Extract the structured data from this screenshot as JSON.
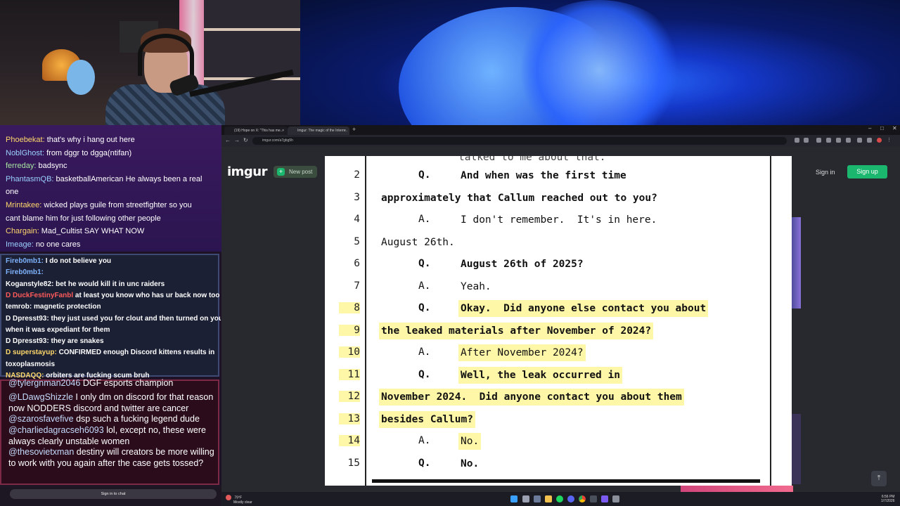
{
  "chat": {
    "top_messages": [
      {
        "user": "Phoebekat:",
        "color": "#ffd86b",
        "text": "that's why i hang out here"
      },
      {
        "user": "NoblGhost:",
        "color": "#9ad1ff",
        "text": "from dggr to dgga(ntifan)"
      },
      {
        "user": "ferreday:",
        "color": "#a8e6a0",
        "text": "badsync"
      },
      {
        "user": "PhantasmQB:",
        "color": "#9ad1ff",
        "text": "basketballAmerican He always been a real"
      },
      {
        "user": "",
        "color": "#ffffff",
        "text": "one"
      },
      {
        "user": "Mrintakee:",
        "color": "#ffd86b",
        "text": "wicked plays guile from streetfighter so you"
      },
      {
        "user": "",
        "color": "#ffffff",
        "text": "cant blame him for just following other people"
      },
      {
        "user": "Chargain:",
        "color": "#ffd86b",
        "text": "Mad_Cultist SAY WHAT NOW"
      },
      {
        "user": "Imeage:",
        "color": "#9ad1ff",
        "text": "no one cares"
      }
    ],
    "mid_messages": [
      {
        "user": "Fireb0mb1:",
        "color": "#7fb4ff",
        "text": "I do not believe you"
      },
      {
        "user": "Fireb0mb1:",
        "color": "#7fb4ff",
        "text": ""
      },
      {
        "user": "Koganstyle82:",
        "color": "#ffffff",
        "text": "bet he would kill it in unc raiders"
      },
      {
        "user": "D DuckFestinyFanbl",
        "color": "#ff5a5a",
        "text": "at least you know who has ur back now too"
      },
      {
        "user": "temrob:",
        "color": "#ffffff",
        "text": "magnetic protection"
      },
      {
        "user": "D Dpresst93:",
        "color": "#ffffff",
        "text": "they just used you for clout and then turned on you"
      },
      {
        "user": "",
        "color": "#ffffff",
        "text": "when it was expediant for them"
      },
      {
        "user": "D Dpresst93:",
        "color": "#ffffff",
        "text": "they are snakes"
      },
      {
        "user": "D superstayup:",
        "color": "#ffd86b",
        "text": "CONFIRMED enough Discord kittens results in"
      },
      {
        "user": "",
        "color": "#ffffff",
        "text": "toxoplasmosis"
      },
      {
        "user": "NASDAQQ:",
        "color": "#ffd86b",
        "text": "orbiters are fucking scum bruh"
      }
    ],
    "bottom_messages": [
      {
        "mention": "@tylergnman2046",
        "text": "DGF esports champion"
      },
      {
        "mention": "@LDawgShizzle",
        "text": "I only dm on discord for that reason now NODDERS discord and twitter are cancer"
      },
      {
        "mention": "@szarosfavefive",
        "text": "dsp such a fucking legend dude"
      },
      {
        "mention": "@charliedagracseh6093",
        "text": "lol, except no, these were always clearly unstable women"
      },
      {
        "mention": "@thesovietxman",
        "text": "destiny will creators be more willing to work with you again after the case gets tossed?"
      }
    ],
    "signin_label": "Sign in to chat"
  },
  "browser": {
    "tabs": [
      {
        "label": "(19) Hope on X: \"This has me...",
        "active": false
      },
      {
        "label": "Imgur: The magic of the Intern...",
        "active": true
      }
    ],
    "new_tab_label": "+",
    "url": "imgur.com/a7gbg5h",
    "window_controls": [
      "–",
      "□",
      "✕"
    ],
    "nav_icons": [
      "←",
      "→",
      "↻"
    ]
  },
  "imgur": {
    "logo": "imgur",
    "new_post_label": "New post",
    "sign_in_label": "Sign in",
    "sign_up_label": "Sign up",
    "scroll_top_icon": "⤒"
  },
  "document": {
    "partial_top": "talked to me about that.",
    "lines": [
      {
        "num": "2",
        "tag": "Q.",
        "text": "And when was the first time",
        "bold": true,
        "indent": true,
        "highlight": false
      },
      {
        "num": "3",
        "tag": "",
        "text": "approximately that Callum reached out to you?",
        "bold": true,
        "indent": false,
        "highlight": false
      },
      {
        "num": "4",
        "tag": "A.",
        "text": "I don't remember.  It's in here.",
        "bold": false,
        "indent": true,
        "highlight": false
      },
      {
        "num": "5",
        "tag": "",
        "text": "August 26th.",
        "bold": false,
        "indent": false,
        "highlight": false
      },
      {
        "num": "6",
        "tag": "Q.",
        "text": "August 26th of 2025?",
        "bold": true,
        "indent": true,
        "highlight": false
      },
      {
        "num": "7",
        "tag": "A.",
        "text": "Yeah.",
        "bold": false,
        "indent": true,
        "highlight": false
      },
      {
        "num": "8",
        "tag": "Q.",
        "text": "Okay.  Did anyone else contact you about",
        "bold": true,
        "indent": true,
        "highlight": true
      },
      {
        "num": "9",
        "tag": "",
        "text": "the leaked materials after November of 2024?",
        "bold": true,
        "indent": false,
        "highlight": true
      },
      {
        "num": "10",
        "tag": "A.",
        "text": "After November 2024?",
        "bold": false,
        "indent": true,
        "highlight": true
      },
      {
        "num": "11",
        "tag": "Q.",
        "text": "Well, the leak occurred in",
        "bold": true,
        "indent": true,
        "highlight": true
      },
      {
        "num": "12",
        "tag": "",
        "text": "November 2024.  Did anyone contact you about them",
        "bold": true,
        "indent": false,
        "highlight": true
      },
      {
        "num": "13",
        "tag": "",
        "text": "besides Callum?",
        "bold": true,
        "indent": false,
        "highlight": true
      },
      {
        "num": "14",
        "tag": "A.",
        "text": "No.",
        "bold": false,
        "indent": true,
        "highlight": true
      },
      {
        "num": "15",
        "tag": "Q.",
        "text": "No.",
        "bold": true,
        "indent": true,
        "highlight": false
      }
    ],
    "highlight_color": "#fff7a8"
  },
  "taskbar": {
    "weather_temp": "79°F",
    "weather_desc": "Mostly clear",
    "time": "6:56 PM",
    "date": "1/7/2026",
    "icons": [
      "start-icon",
      "search-icon",
      "file-explorer-icon",
      "folder-icon",
      "spotify-icon",
      "discord-icon",
      "chrome-icon",
      "app-icon",
      "obs-icon",
      "settings-icon"
    ]
  }
}
